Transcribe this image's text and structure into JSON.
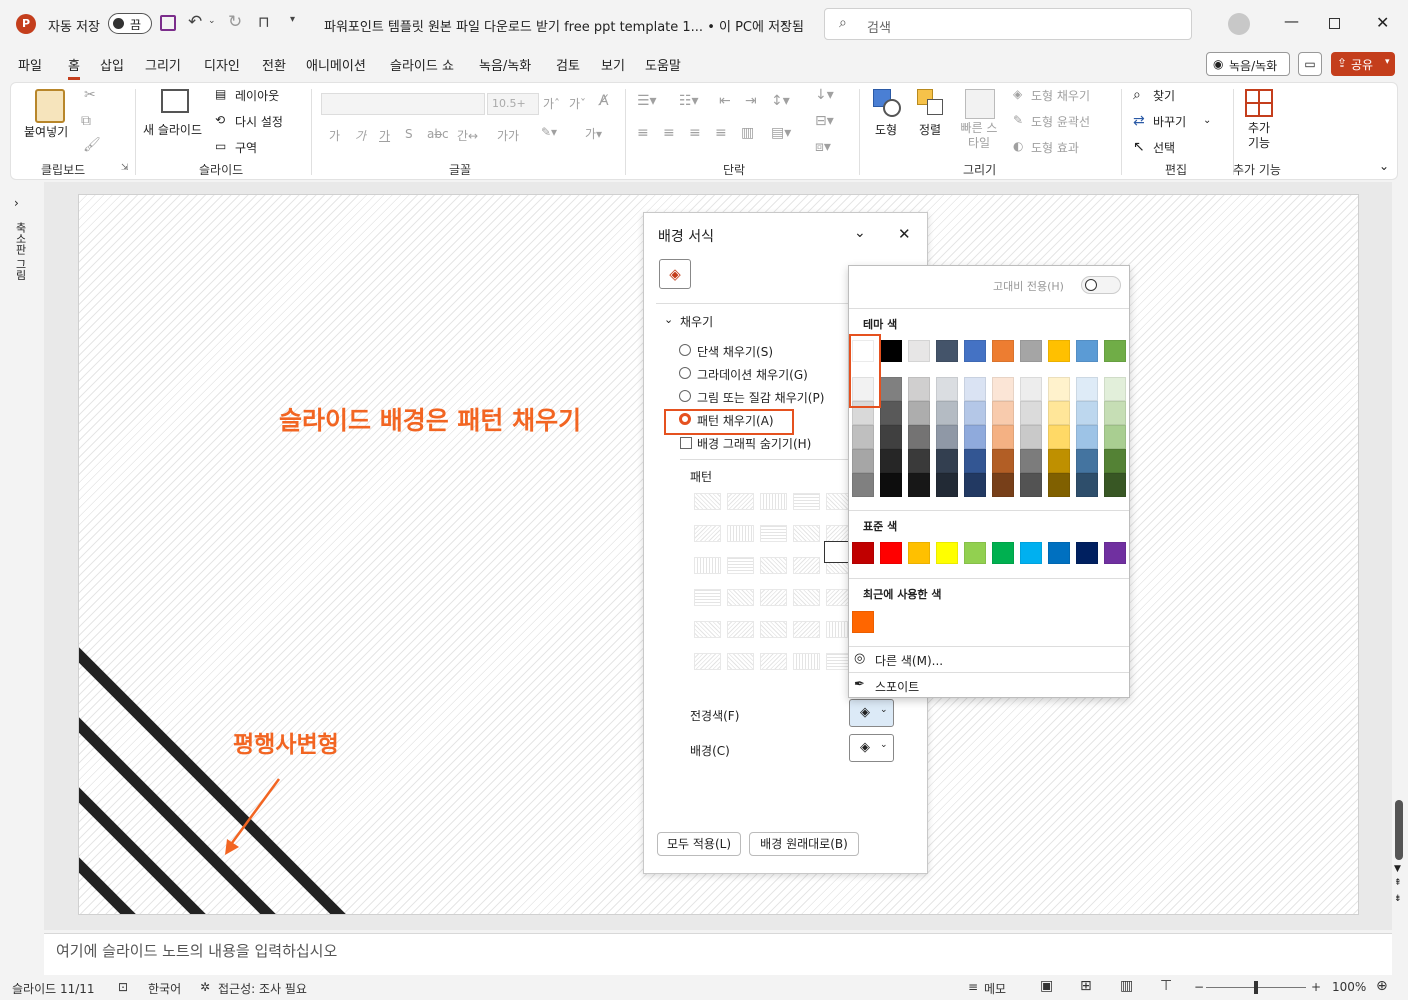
{
  "titlebar": {
    "autosave_label": "자동 저장",
    "autosave_state": "끔",
    "doc_title": "파워포인트 템플릿 원본 파일 다운로드 받기 free ppt template 1... • 이 PC에 저장됨",
    "search_placeholder": "검색"
  },
  "menu": {
    "tabs": [
      "파일",
      "홈",
      "삽입",
      "그리기",
      "디자인",
      "전환",
      "애니메이션",
      "슬라이드 쇼",
      "녹음/녹화",
      "검토",
      "보기",
      "도움말"
    ],
    "record_button": "녹음/녹화",
    "share_button": "공유"
  },
  "ribbon": {
    "clipboard": {
      "paste": "붙여넣기",
      "group": "클립보드"
    },
    "slides": {
      "new_slide": "새 슬라이드",
      "layout": "레이아웃",
      "reset": "다시 설정",
      "section": "구역",
      "group": "슬라이드"
    },
    "font": {
      "size": "10.5+",
      "group": "글꼴"
    },
    "paragraph": {
      "group": "단락"
    },
    "drawing": {
      "shapes": "도형",
      "arrange": "정렬",
      "quick_styles": "빠른 스타일",
      "shape_fill": "도형 채우기",
      "shape_outline": "도형 윤곽선",
      "shape_effects": "도형 효과",
      "group": "그리기"
    },
    "editing": {
      "find": "찾기",
      "replace": "바꾸기",
      "select": "선택",
      "group": "편집"
    },
    "addins": {
      "label": "추가 기능",
      "group": "추가 기능"
    }
  },
  "left_pane": {
    "label": "축소판 그림"
  },
  "slide": {
    "title_annotation": "슬라이드 배경은 패턴 채우기",
    "shape_annotation": "평행사변형"
  },
  "format_panel": {
    "title": "배경 서식",
    "section": "채우기",
    "options": [
      "단색 채우기(S)",
      "그라데이션 채우기(G)",
      "그림 또는 질감 채우기(P)",
      "패턴 채우기(A)",
      "배경 그래픽 숨기기(H)"
    ],
    "selected_option": "패턴 채우기(A)",
    "pattern_label": "패턴",
    "foreground_label": "전경색(F)",
    "background_label": "배경(C)",
    "apply_all": "모두 적용(L)",
    "reset": "배경 원래대로(B)"
  },
  "color_picker": {
    "high_contrast": "고대비 전용(H)",
    "theme_title": "테마 색",
    "theme_top": [
      "#ffffff",
      "#000000",
      "#e7e6e6",
      "#44546a",
      "#4472c4",
      "#ed7d31",
      "#a5a5a5",
      "#ffc000",
      "#5b9bd5",
      "#70ad47"
    ],
    "standard_title": "표준 색",
    "standard": [
      "#c00000",
      "#ff0000",
      "#ffc000",
      "#ffff00",
      "#92d050",
      "#00b050",
      "#00b0f0",
      "#0070c0",
      "#002060",
      "#7030a0"
    ],
    "recent_title": "최근에 사용한 색",
    "recent": [
      "#ff6600"
    ],
    "more_colors": "다른 색(M)...",
    "eyedropper": "스포이트"
  },
  "notes": {
    "placeholder": "여기에 슬라이드 노트의 내용을 입력하십시오"
  },
  "status": {
    "slide_info": "슬라이드 11/11",
    "language": "한국어",
    "accessibility": "접근성: 조사 필요",
    "notes_btn": "메모",
    "zoom": "100%"
  },
  "colors": {
    "accent": "#e5511f",
    "annotation": "#f26522",
    "title_bar": "#c43e1c"
  }
}
